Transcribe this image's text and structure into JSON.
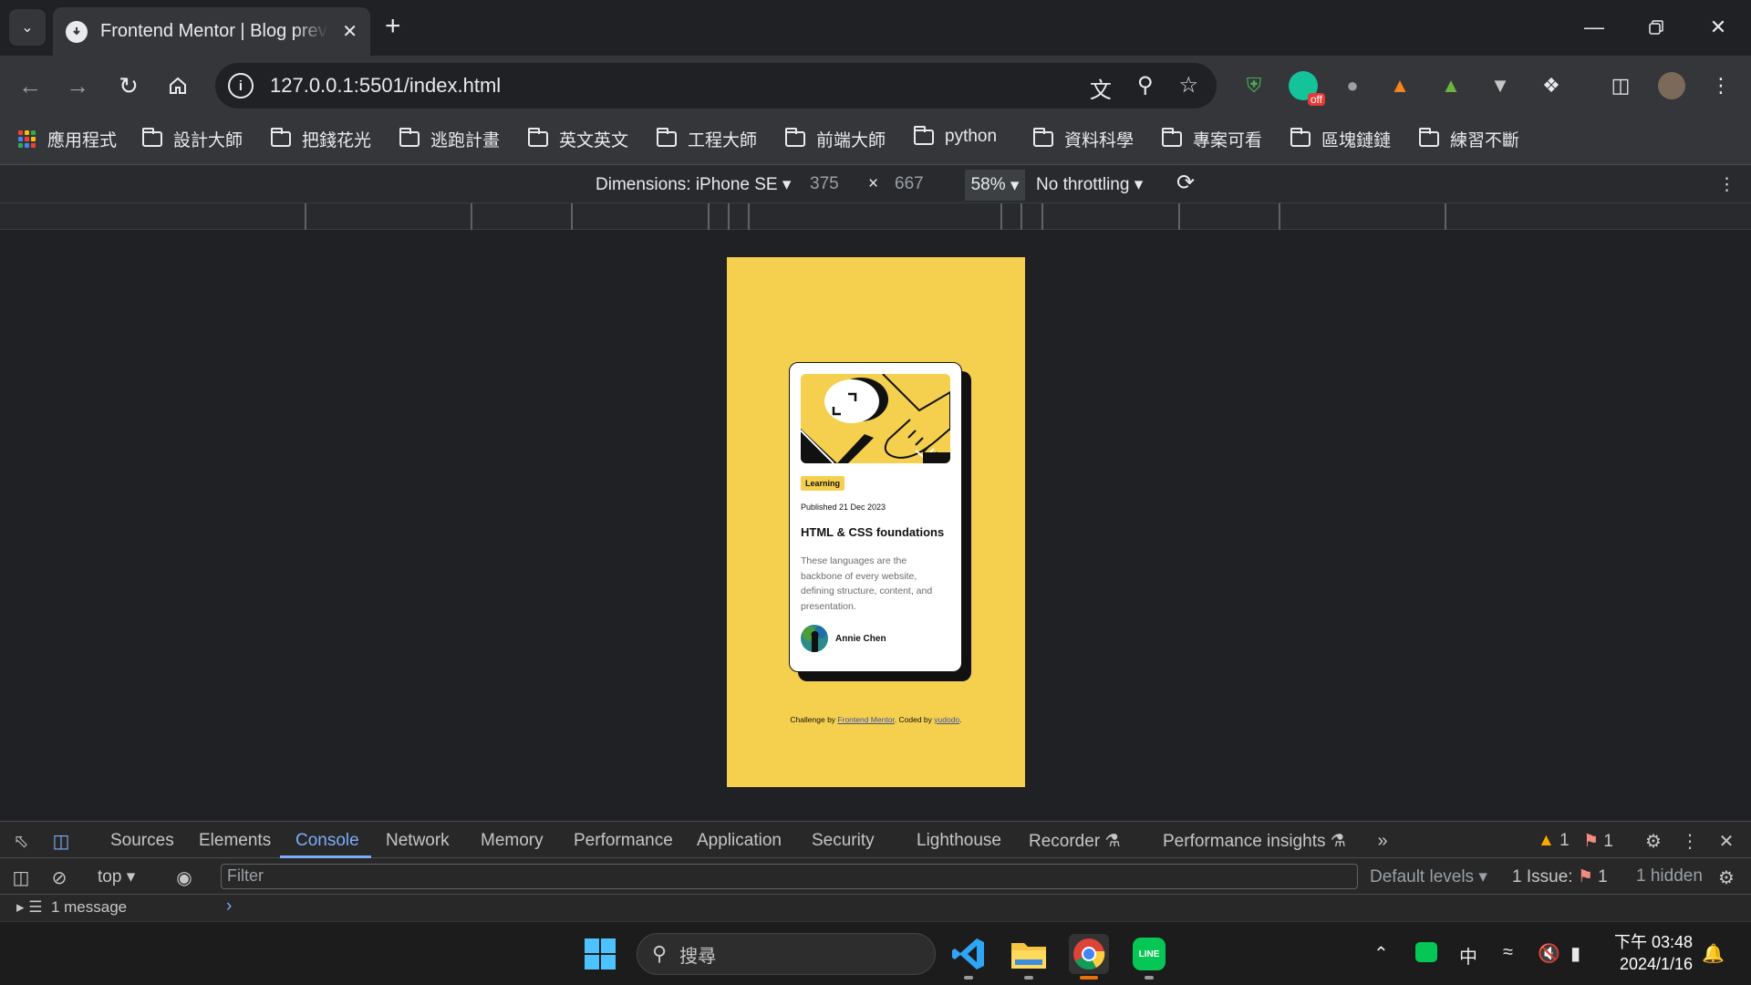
{
  "browser": {
    "tab_title": "Frontend Mentor | Blog preview card",
    "url": "127.0.0.1:5501/index.html",
    "extension_badge": "off",
    "bookmarks": [
      "應用程式",
      "設計大師",
      "把錢花光",
      "逃跑計畫",
      "英文英文",
      "工程大師",
      "前端大師",
      "python",
      "資料科學",
      "專案可看",
      "區塊鏈鏈",
      "練習不斷"
    ]
  },
  "device_toolbar": {
    "dimensions_label": "Dimensions: iPhone SE",
    "width": "375",
    "times": "×",
    "height": "667",
    "zoom": "58%",
    "throttling": "No throttling"
  },
  "card": {
    "tag": "Learning",
    "published": "Published 21 Dec 2023",
    "title": "HTML & CSS foundations",
    "description": "These languages are the backbone of every website, defining structure, content, and presentation.",
    "author": "Annie Chen"
  },
  "attribution": {
    "prefix": "Challenge by",
    "link1": "Frontend Mentor",
    "middle": ". Coded by",
    "link2": "yudodo",
    "suffix": "."
  },
  "devtools": {
    "tabs": [
      "Sources",
      "Elements",
      "Console",
      "Network",
      "Memory",
      "Performance",
      "Application",
      "Security",
      "Lighthouse",
      "Recorder",
      "Performance insights"
    ],
    "active_tab": "Console",
    "warnings": "1",
    "issues_count": "1",
    "context": "top",
    "filter_placeholder": "Filter",
    "default_levels": "Default levels",
    "issue_label": "1 Issue:",
    "issue_num": "1",
    "hidden": "1 hidden",
    "messages": "1 message"
  },
  "taskbar": {
    "search_placeholder": "搜尋",
    "ime": "中",
    "time": "下午 03:48",
    "date": "2024/1/16"
  },
  "colors": {
    "page_bg": "#f4d04e",
    "accent_blue": "#7cacf8"
  }
}
